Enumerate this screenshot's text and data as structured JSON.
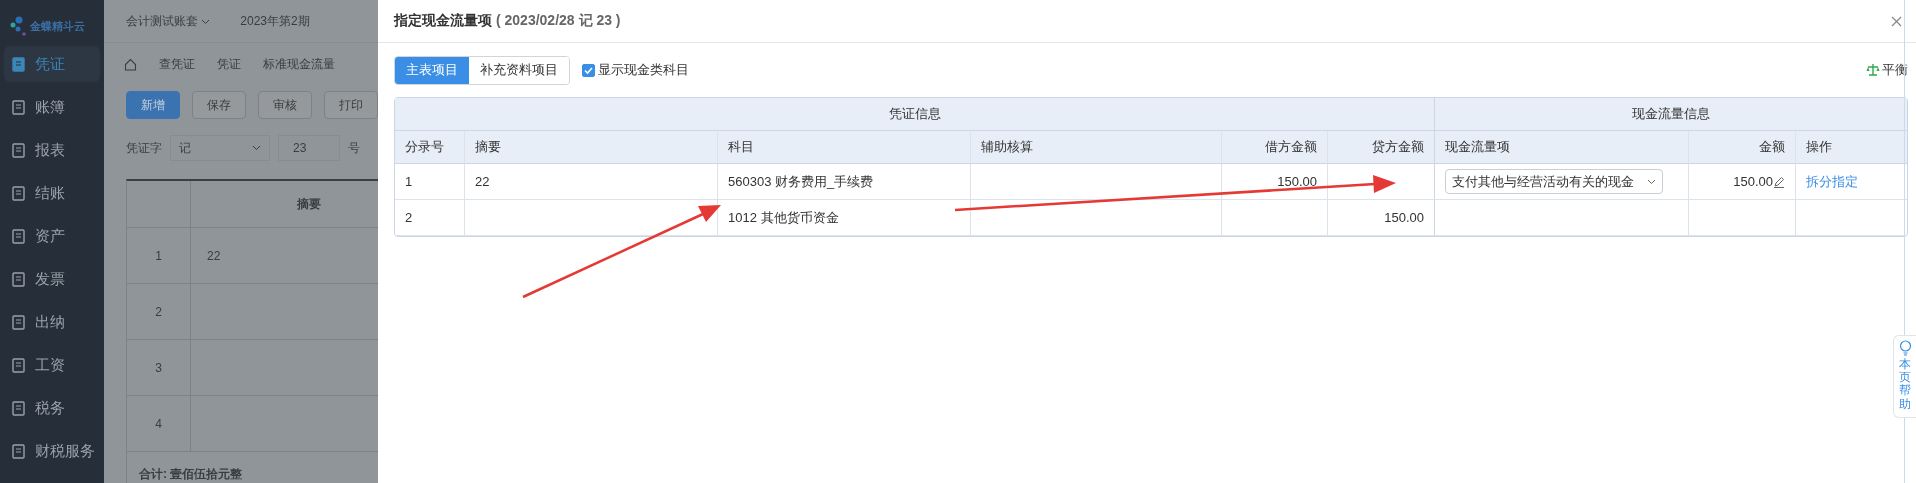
{
  "sidebar": {
    "logo": "金蝶精斗云",
    "items": [
      {
        "label": "凭证",
        "selected": true
      },
      {
        "label": "账簿",
        "selected": false
      },
      {
        "label": "报表",
        "selected": false
      },
      {
        "label": "结账",
        "selected": false
      },
      {
        "label": "资产",
        "selected": false
      },
      {
        "label": "发票",
        "selected": false
      },
      {
        "label": "出纳",
        "selected": false
      },
      {
        "label": "工资",
        "selected": false
      },
      {
        "label": "税务",
        "selected": false
      },
      {
        "label": "财税服务",
        "selected": false
      }
    ]
  },
  "background": {
    "account_book": "会计测试账套",
    "period": "2023年第2期",
    "tabs": [
      "查凭证",
      "凭证",
      "标准现金流量"
    ],
    "buttons": [
      {
        "label": "新增",
        "primary": true
      },
      {
        "label": "保存",
        "primary": false
      },
      {
        "label": "审核",
        "primary": false
      },
      {
        "label": "打印",
        "primary": false
      }
    ],
    "voucher_word_label": "凭证字",
    "voucher_word": "记",
    "voucher_number": "23",
    "number_suffix": "号",
    "table": {
      "header": "摘要",
      "rows": [
        {
          "no": "1",
          "summary": "22"
        },
        {
          "no": "2"
        },
        {
          "no": "3"
        },
        {
          "no": "4"
        }
      ],
      "total": "合计: 壹佰伍拾元整"
    }
  },
  "dialog": {
    "title": "指定现金流量项",
    "title_detail": "( 2023/02/28 记 23 )",
    "tabs": [
      {
        "label": "主表项目",
        "selected": true
      },
      {
        "label": "补充资料项目",
        "selected": false
      }
    ],
    "show_cash_accounts": {
      "label": "显示现金类科目",
      "checked": true
    },
    "balance": "平衡",
    "table": {
      "groups": [
        "凭证信息",
        "现金流量信息"
      ],
      "columns": [
        "分录号",
        "摘要",
        "科目",
        "辅助核算",
        "借方金额",
        "贷方金额",
        "现金流量项",
        "金额",
        "操作"
      ],
      "rows": [
        {
          "entry": "1",
          "summary": "22",
          "account": "560303 财务费用_手续费",
          "debit": "150.00",
          "cash_flow_item": "支付其他与经营活动有关的现金",
          "amount": "150.00",
          "action": "拆分指定"
        },
        {
          "entry": "2",
          "account": "1012 其他货币资金",
          "credit": "150.00"
        }
      ]
    }
  },
  "help_tab": "本页帮助"
}
